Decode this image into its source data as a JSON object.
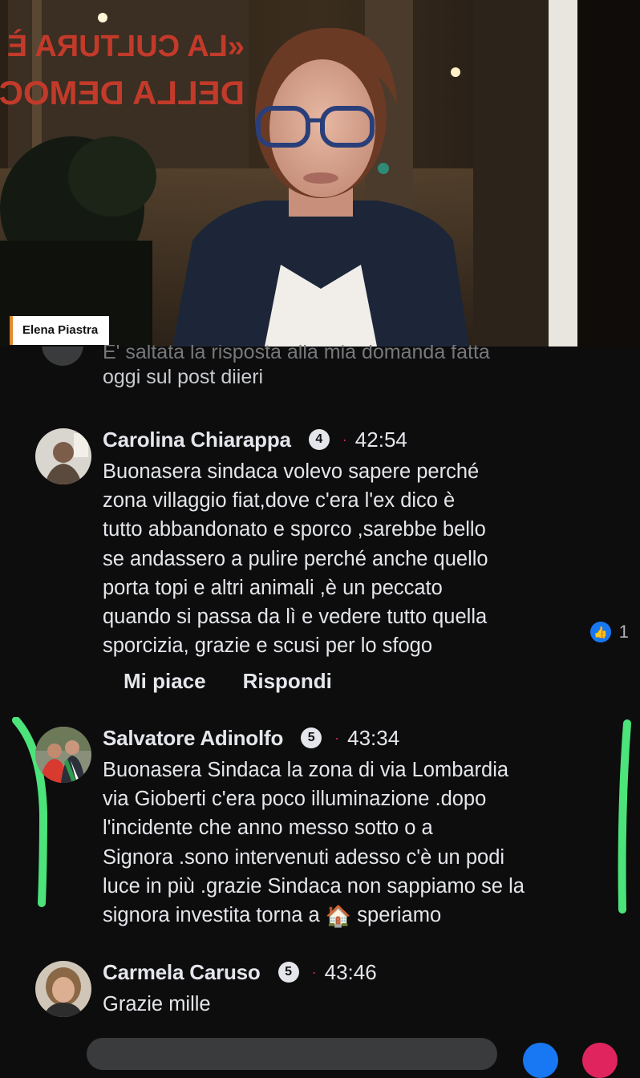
{
  "video": {
    "speaker_name": "Elena Piastra",
    "sign_lines": [
      "«LA CULTURA È",
      "DELLA DEMOC"
    ],
    "colors": {
      "name_tag_accent": "#e5892b"
    }
  },
  "previous_comment": {
    "text_cut": "E' saltata la risposta alla mia domanda fatta",
    "text": "oggi sul post diieri"
  },
  "comments": [
    {
      "author": "Carolina Chiarappa",
      "badge": "4",
      "separator": "·",
      "time": "42:54",
      "lines": [
        "Buonasera sindaca volevo sapere perché",
        "zona villaggio fiat,dove c'era l'ex dico è",
        "tutto abbandonato e sporco ,sarebbe bello",
        "se andassero a pulire perché anche quello",
        "porta topi e altri animali ,è un peccato",
        "quando si passa da lì e vedere tutto quella",
        "sporcizia, grazie e scusi per lo sfogo"
      ],
      "like_icon": "like-thumb-icon",
      "like_count": "1",
      "actions": {
        "like": "Mi piace",
        "reply": "Rispondi"
      }
    },
    {
      "author": "Salvatore Adinolfo",
      "badge": "5",
      "separator": "·",
      "time": "43:34",
      "lines": [
        "Buonasera Sindaca la zona di via Lombardia",
        "via Gioberti  c'era poco  illuminazione .dopo",
        "l'incidente che anno messo sotto o a",
        "Signora .sono intervenuti adesso c'è un podi",
        "luce in più .grazie Sindaca non sappiamo se la"
      ],
      "last_line_before": "signora investita torna a ",
      "house_icon": "🏠",
      "last_line_after": " speriamo",
      "highlight_color": "#4be37a"
    },
    {
      "author": "Carmela Caruso",
      "badge": "5",
      "separator": "·",
      "time": "43:46",
      "lines": [
        "Grazie mille"
      ]
    }
  ]
}
